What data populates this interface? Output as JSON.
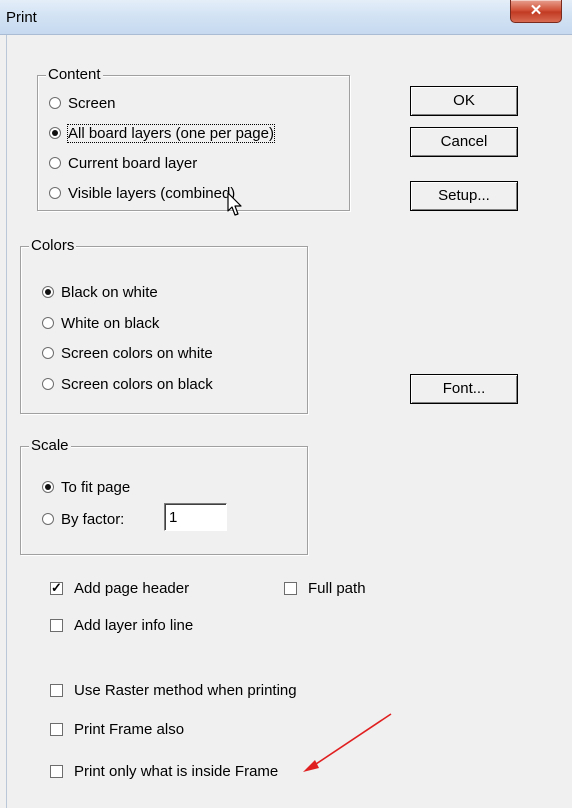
{
  "window": {
    "title": "Print",
    "close_glyph": "✕"
  },
  "content_group": {
    "legend": "Content",
    "options": [
      {
        "label": "Screen",
        "selected": false
      },
      {
        "label": "All board layers (one per page)",
        "selected": true
      },
      {
        "label": "Current board layer",
        "selected": false
      },
      {
        "label": "Visible layers (combined)",
        "selected": false
      }
    ]
  },
  "colors_group": {
    "legend": "Colors",
    "options": [
      {
        "label": "Black on white",
        "selected": true
      },
      {
        "label": "White on black",
        "selected": false
      },
      {
        "label": "Screen colors on white",
        "selected": false
      },
      {
        "label": "Screen colors on black",
        "selected": false
      }
    ]
  },
  "scale_group": {
    "legend": "Scale",
    "options": [
      {
        "label": "To fit page",
        "selected": true
      },
      {
        "label": "By factor:",
        "selected": false
      }
    ],
    "factor_value": "1"
  },
  "checkboxes": {
    "add_page_header": {
      "label": "Add page header",
      "checked": true
    },
    "full_path": {
      "label": "Full path",
      "checked": false
    },
    "add_layer_info": {
      "label": "Add layer info line",
      "checked": false
    },
    "use_raster": {
      "label": "Use Raster method when printing",
      "checked": false
    },
    "print_frame": {
      "label": "Print Frame also",
      "checked": false
    },
    "print_inside_frame": {
      "label": "Print only what is inside Frame",
      "checked": false
    }
  },
  "buttons": {
    "ok": "OK",
    "cancel": "Cancel",
    "setup": "Setup...",
    "font": "Font..."
  },
  "icons": {
    "close": "close-icon",
    "cursor": "mouse-pointer-icon",
    "annotation": "red-arrow-annotation",
    "annotation_color": "#e02020"
  }
}
